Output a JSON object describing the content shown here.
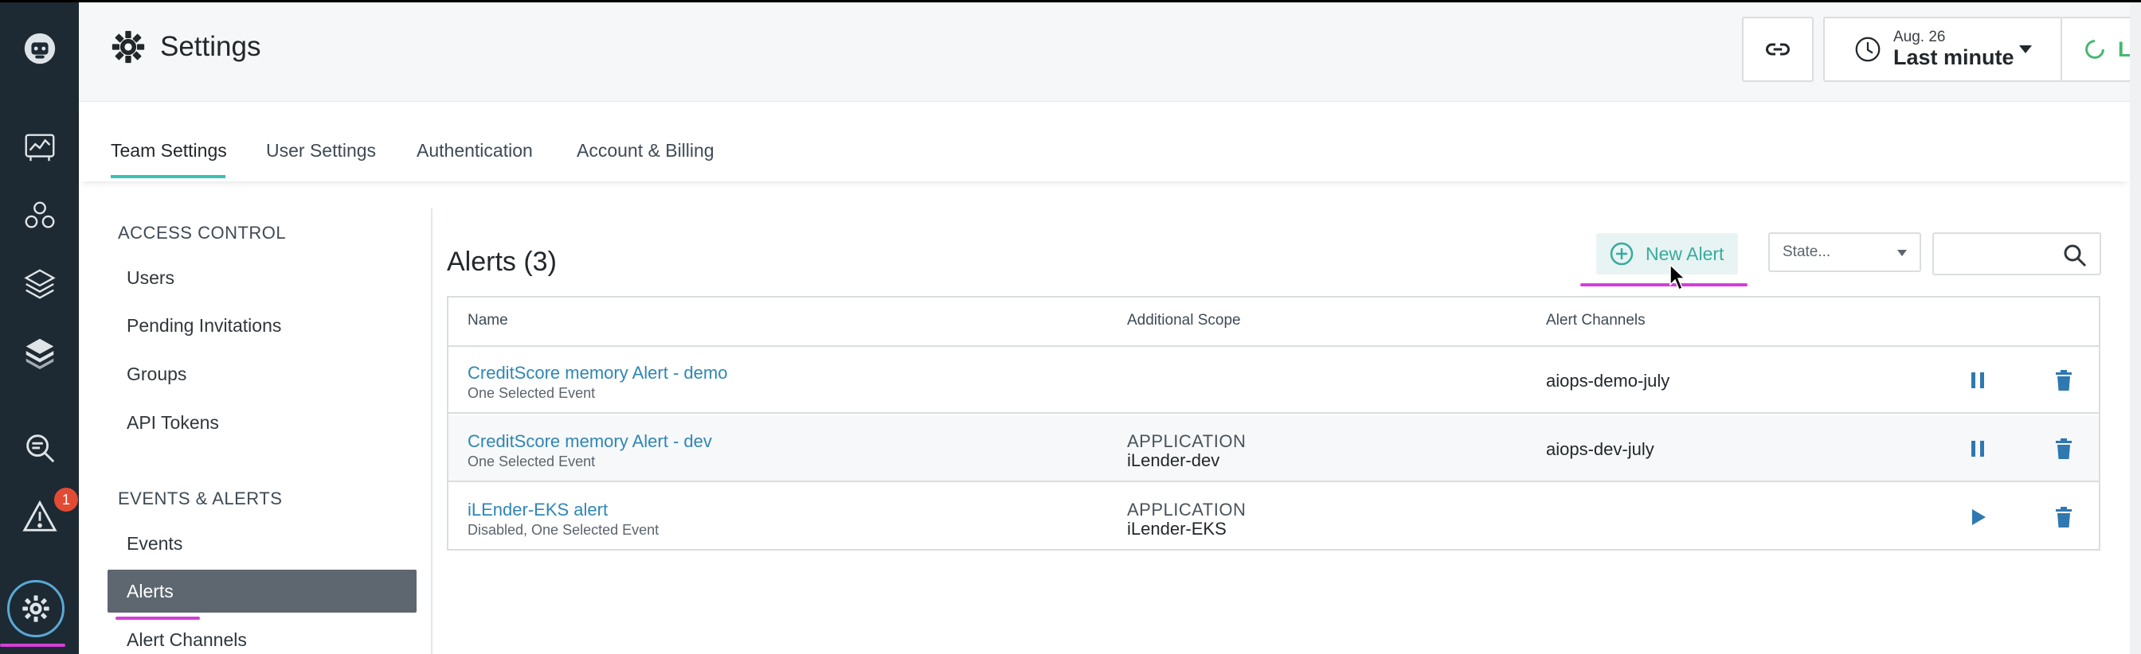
{
  "header": {
    "title": "Settings",
    "time": {
      "date": "Aug. 26",
      "range": "Last minute"
    },
    "live_label": "Live"
  },
  "rail": {
    "items": [
      "logo-icon",
      "dashboards-icon",
      "infrastructure-icon",
      "applications-icon",
      "layers-icon",
      "analytics-icon",
      "events-icon",
      "settings-icon"
    ],
    "events_badge": "1"
  },
  "tabs": [
    "Team Settings",
    "User Settings",
    "Authentication",
    "Account & Billing"
  ],
  "nav": {
    "access_control": {
      "title": "ACCESS CONTROL",
      "items": [
        "Users",
        "Pending Invitations",
        "Groups",
        "API Tokens"
      ]
    },
    "events_alerts": {
      "title": "EVENTS & ALERTS",
      "items": [
        "Events",
        "Alerts",
        "Alert Channels"
      ]
    }
  },
  "alerts": {
    "title": "Alerts (3)",
    "new_button": "New Alert",
    "state_placeholder": "State...",
    "search_placeholder": "",
    "columns": [
      "Name",
      "Additional Scope",
      "Alert Channels"
    ],
    "rows": [
      {
        "name": "CreditScore memory Alert - demo",
        "sub": "One Selected Event",
        "scope_type": "",
        "scope_value": "",
        "channel": "aiops-demo-july",
        "action": "pause"
      },
      {
        "name": "CreditScore memory Alert - dev",
        "sub": "One Selected Event",
        "scope_type": "APPLICATION",
        "scope_value": "iLender-dev",
        "channel": "aiops-dev-july",
        "action": "pause"
      },
      {
        "name": "iLEnder-EKS alert",
        "sub": "Disabled, One Selected Event",
        "scope_type": "APPLICATION",
        "scope_value": "iLender-EKS",
        "channel": "",
        "action": "play"
      }
    ]
  },
  "colors": {
    "rail_bg": "#1d2a33",
    "accent_teal": "#39c0b3",
    "link_blue": "#2f86b5",
    "live_green": "#47b870",
    "annotation_magenta": "#d43ed8",
    "selected_nav_bg": "#5e6770"
  }
}
